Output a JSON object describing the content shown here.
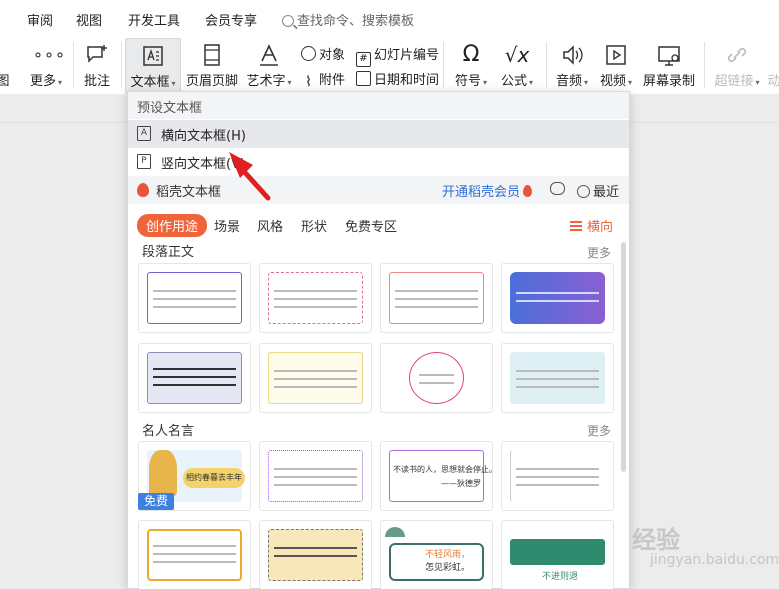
{
  "menu": {
    "tabs": [
      "审阅",
      "视图",
      "开发工具",
      "会员专享"
    ],
    "search_label": "查找命令、搜索模板"
  },
  "ribbon": {
    "partial_left": "图",
    "more": "更多",
    "comment": "批注",
    "textbox": "文本框",
    "header_footer": "页眉页脚",
    "wordart": "艺术字",
    "object": "对象",
    "attachment": "附件",
    "slide_number": "幻灯片编号",
    "datetime": "日期和时间",
    "symbol": "符号",
    "formula": "公式",
    "audio": "音频",
    "video": "视频",
    "screen_record": "屏幕录制",
    "hyperlink": "超链接",
    "partial_right": "动"
  },
  "panel": {
    "preset_header": "预设文本框",
    "horizontal": "横向文本框(H)",
    "vertical": "竖向文本框(V)",
    "daoke": "稻壳文本框",
    "open_member": "开通稻壳会员",
    "recent": "最近",
    "tabs": [
      "创作用途",
      "场景",
      "风格",
      "形状",
      "免费专区"
    ],
    "orientation": "横向",
    "section1": "段落正文",
    "section2": "名人名言",
    "more": "更多",
    "free_badge": "免费",
    "card_texts": [
      "相约春暮去丰年",
      "不读书的人，思想就会停止。",
      "——狄德罗",
      "不轻风雨，",
      "怎见彩虹。",
      "不进则退"
    ]
  },
  "watermark": {
    "text": "经验",
    "sub": "jingyan.baidu.com"
  },
  "colors": {
    "accent": "#f0643c",
    "link": "#2f6fd6",
    "arrow": "#e02020"
  }
}
